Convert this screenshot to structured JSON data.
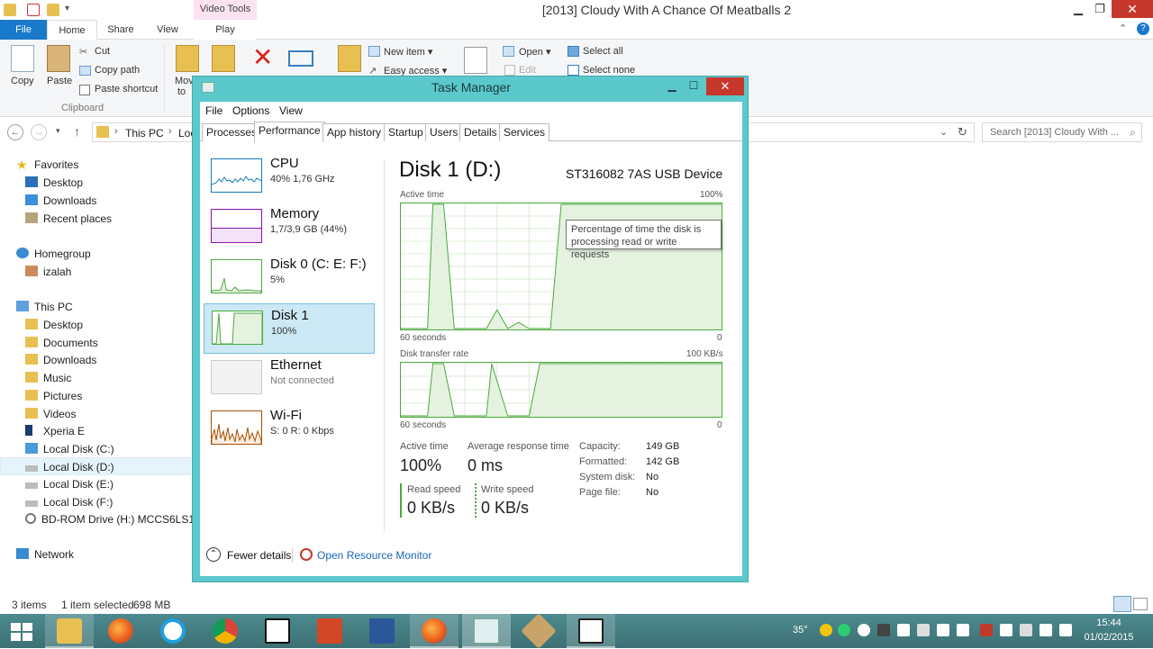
{
  "explorer": {
    "title": "[2013] Cloudy With A Chance Of Meatballs 2",
    "video_tools": "Video Tools",
    "tabs": {
      "file": "File",
      "home": "Home",
      "share": "Share",
      "view": "View",
      "play": "Play"
    },
    "ribbon": {
      "copy": "Copy",
      "paste": "Paste",
      "cut": "Cut",
      "copy_path": "Copy path",
      "paste_shortcut": "Paste shortcut",
      "move_to": "Mov",
      "move_to_2": "to",
      "new_item": "New item",
      "easy_access": "Easy access",
      "open": "Open",
      "edit": "Edit",
      "select_all": "Select all",
      "select_none": "Select none",
      "clipboard_group": "Clipboard"
    },
    "address": {
      "this_pc": "This PC",
      "lo": "Loc"
    },
    "search_placeholder": "Search [2013] Cloudy With ...",
    "nav": {
      "favorites": "Favorites",
      "desktop": "Desktop",
      "downloads": "Downloads",
      "recent_places": "Recent places",
      "homegroup": "Homegroup",
      "user": "izalah",
      "this_pc": "This PC",
      "pc_desktop": "Desktop",
      "documents": "Documents",
      "pc_downloads": "Downloads",
      "music": "Music",
      "pictures": "Pictures",
      "videos": "Videos",
      "xperia": "Xperia E",
      "disk_c": "Local Disk (C:)",
      "disk_d": "Local Disk (D:)",
      "disk_e": "Local Disk (E:)",
      "disk_f": "Local Disk (F:)",
      "bd_rom": "BD-ROM Drive (H:) MCCS6LS16",
      "network": "Network"
    },
    "status": {
      "items": "3 items",
      "selected": "1 item selected",
      "size": "698 MB"
    }
  },
  "taskmanager": {
    "title": "Task Manager",
    "menu": {
      "file": "File",
      "options": "Options",
      "view": "View"
    },
    "tabs": [
      "Processes",
      "Performance",
      "App history",
      "Startup",
      "Users",
      "Details",
      "Services"
    ],
    "perf_items": [
      {
        "name": "CPU",
        "sub": "40%  1,76 GHz"
      },
      {
        "name": "Memory",
        "sub": "1,7/3,9 GB (44%)"
      },
      {
        "name": "Disk 0 (C: E: F:)",
        "sub": "5%"
      },
      {
        "name": "Disk 1",
        "sub": "100%"
      },
      {
        "name": "Ethernet",
        "sub": "Not connected"
      },
      {
        "name": "Wi-Fi",
        "sub": "S: 0  R: 0 Kbps"
      }
    ],
    "detail": {
      "heading": "Disk 1 (D:)",
      "device": "ST316082 7AS USB Device",
      "active_time_label": "Active time",
      "active_time_max": "100%",
      "graph1_left": "60 seconds",
      "graph1_right": "0",
      "transfer_label": "Disk transfer rate",
      "transfer_max": "100 KB/s",
      "graph2_left": "60 seconds",
      "graph2_right": "0",
      "tooltip": "Percentage of time the disk is processing read or write requests",
      "stat_active_label": "Active time",
      "stat_active_value": "100%",
      "stat_resp_label": "Average response time",
      "stat_resp_value": "0 ms",
      "read_label": "Read speed",
      "read_value": "0 KB/s",
      "write_label": "Write speed",
      "write_value": "0 KB/s",
      "props": [
        {
          "k": "Capacity:",
          "v": "149 GB"
        },
        {
          "k": "Formatted:",
          "v": "142 GB"
        },
        {
          "k": "System disk:",
          "v": "No"
        },
        {
          "k": "Page file:",
          "v": "No"
        }
      ]
    },
    "fewer_details": "Fewer details",
    "resource_monitor": "Open Resource Monitor"
  },
  "taskbar": {
    "time": "15:44",
    "date": "01/02/2015",
    "temp": "35°"
  },
  "colors": {
    "disk_green": "#4aaa3c",
    "cpu_blue": "#117dbb",
    "memory_purple": "#8b12ae",
    "wifi_orange": "#a74f01",
    "tm_frame": "#5bc8cc"
  },
  "chart_data": [
    {
      "type": "area",
      "ylabel": "Active time",
      "xlabel": "60 seconds",
      "ylim": [
        0,
        100
      ],
      "x": [
        60,
        58,
        55,
        54,
        52,
        50,
        48,
        46,
        44,
        42,
        40,
        38,
        36,
        34,
        32,
        30,
        28,
        26,
        24,
        22,
        20,
        18,
        16,
        14,
        12,
        10,
        8,
        6,
        4,
        2,
        0
      ],
      "values": [
        0,
        0,
        0,
        100,
        100,
        0,
        0,
        0,
        0,
        15,
        0,
        5,
        0,
        0,
        0,
        100,
        100,
        100,
        100,
        100,
        100,
        100,
        100,
        100,
        100,
        100,
        100,
        100,
        100,
        100,
        100
      ]
    },
    {
      "type": "area",
      "ylabel": "Disk transfer rate",
      "xlabel": "60 seconds",
      "ylim": [
        0,
        100
      ],
      "x": [
        60,
        55,
        54,
        52,
        50,
        47,
        46,
        44,
        43,
        40,
        38,
        36,
        34,
        33,
        32,
        30,
        0
      ],
      "values": [
        0,
        0,
        100,
        100,
        0,
        0,
        0,
        0,
        100,
        0,
        0,
        0,
        100,
        100,
        100,
        100,
        100
      ]
    }
  ]
}
